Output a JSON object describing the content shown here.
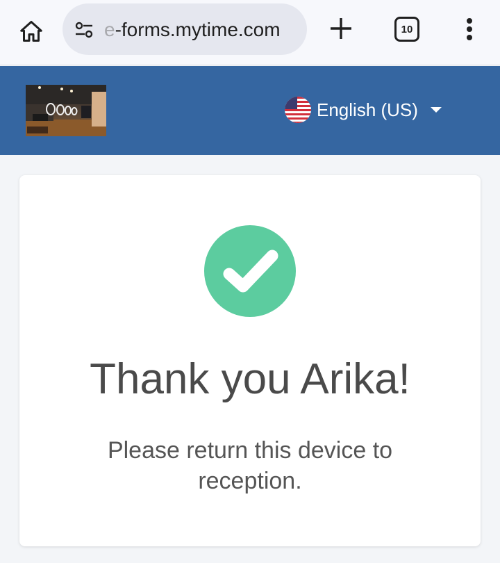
{
  "browser": {
    "url_prefix": "e",
    "url_text": "-forms.mytime.com",
    "tab_count": "10"
  },
  "header": {
    "language_label": "English (US)",
    "brand_color": "#3566a1"
  },
  "card": {
    "title": "Thank you Arika!",
    "message": "Please return this device to reception.",
    "success_color": "#5ccc9f"
  },
  "icons": {
    "home": "home-icon",
    "site_settings": "tune-icon",
    "new_tab": "plus-icon",
    "tab_switcher": "tabs-icon",
    "menu": "more-vert-icon",
    "flag": "us-flag-icon",
    "dropdown": "caret-down-icon",
    "success": "checkmark-icon"
  }
}
